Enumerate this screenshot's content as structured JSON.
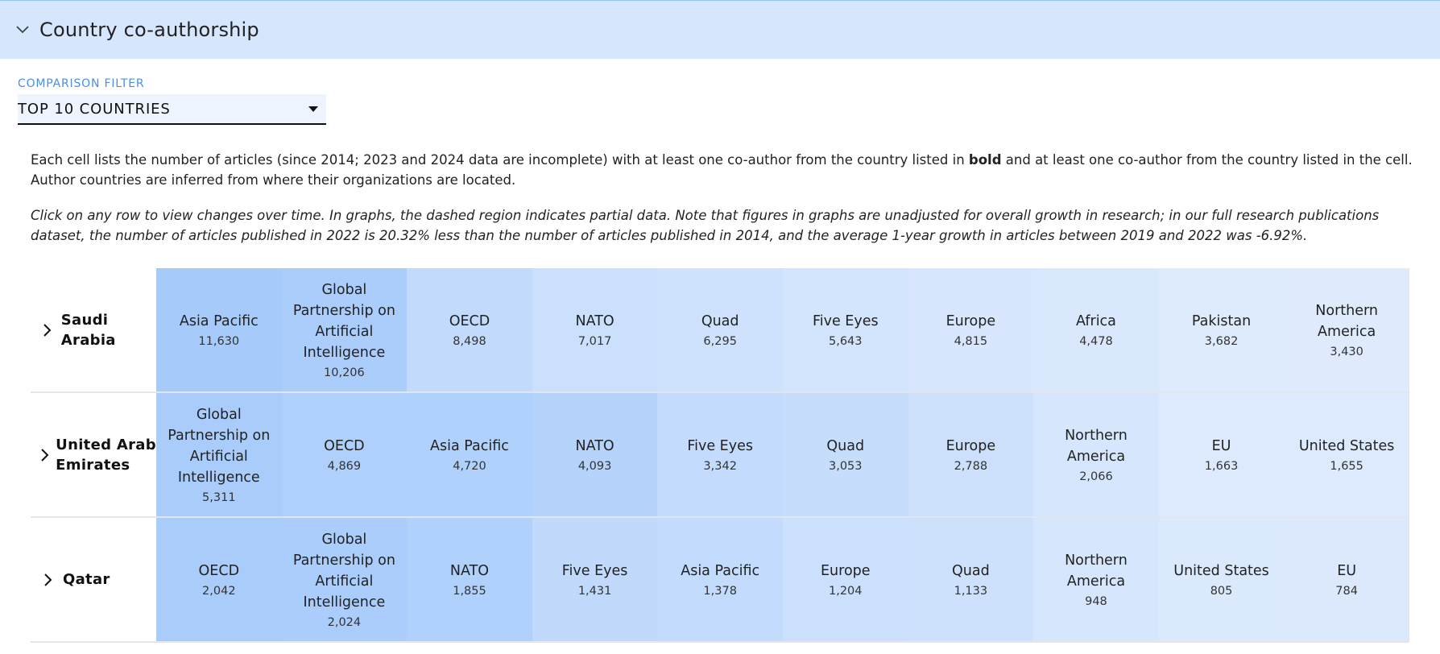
{
  "section": {
    "title": "Country co-authorship"
  },
  "filter": {
    "label": "COMPARISON FILTER",
    "value": "TOP 10 COUNTRIES"
  },
  "description": {
    "line1_pre": "Each cell lists the number of articles (since 2014; 2023 and 2024 data are incomplete) with at least one co-author from the country listed in ",
    "line1_bold": "bold",
    "line1_post": " and at least one co-author from the country listed in the cell. Author countries are inferred from where their organizations are located.",
    "note": "Click on any row to view changes over time. In graphs, the dashed region indicates partial data. Note that figures in graphs are unadjusted for overall growth in research; in our full research publications dataset, the number of articles published in 2022 is 20.32% less than the number of articles published in 2014, and the average 1-year growth in articles between 2019 and 2022 was -6.92%."
  },
  "rows": [
    {
      "name": "Saudi Arabia",
      "cells": [
        {
          "label": "Asia Pacific",
          "value": "11,630",
          "color": "#a6cbfb"
        },
        {
          "label": "Global Partnership on Artificial Intelligence",
          "value": "10,206",
          "color": "#aacdfb"
        },
        {
          "label": "OECD",
          "value": "8,498",
          "color": "#c2dbfc"
        },
        {
          "label": "NATO",
          "value": "7,017",
          "color": "#cbe0fc"
        },
        {
          "label": "Quad",
          "value": "6,295",
          "color": "#cfe2fd"
        },
        {
          "label": "Five Eyes",
          "value": "5,643",
          "color": "#d3e4fd"
        },
        {
          "label": "Europe",
          "value": "4,815",
          "color": "#d8e7fd"
        },
        {
          "label": "Africa",
          "value": "4,478",
          "color": "#dae8fd"
        },
        {
          "label": "Pakistan",
          "value": "3,682",
          "color": "#deebfd"
        },
        {
          "label": "Northern America",
          "value": "3,430",
          "color": "#dfebfd"
        }
      ]
    },
    {
      "name": "United Arab Emirates",
      "cells": [
        {
          "label": "Global Partnership on Artificial Intelligence",
          "value": "5,311",
          "color": "#a9ccfb"
        },
        {
          "label": "OECD",
          "value": "4,869",
          "color": "#aed0fb"
        },
        {
          "label": "Asia Pacific",
          "value": "4,720",
          "color": "#b0d1fb"
        },
        {
          "label": "NATO",
          "value": "4,093",
          "color": "#b6d4fb"
        },
        {
          "label": "Five Eyes",
          "value": "3,342",
          "color": "#c3dbfc"
        },
        {
          "label": "Quad",
          "value": "3,053",
          "color": "#c7ddfc"
        },
        {
          "label": "Europe",
          "value": "2,788",
          "color": "#cce0fc"
        },
        {
          "label": "Northern America",
          "value": "2,066",
          "color": "#d6e6fd"
        },
        {
          "label": "EU",
          "value": "1,663",
          "color": "#ddeafd"
        },
        {
          "label": "United States",
          "value": "1,655",
          "color": "#ddeafd"
        }
      ]
    },
    {
      "name": "Qatar",
      "cells": [
        {
          "label": "OECD",
          "value": "2,042",
          "color": "#a9ccfb"
        },
        {
          "label": "Global Partnership on Artificial Intelligence",
          "value": "2,024",
          "color": "#aacdfb"
        },
        {
          "label": "NATO",
          "value": "1,855",
          "color": "#b0d1fb"
        },
        {
          "label": "Five Eyes",
          "value": "1,431",
          "color": "#c1dafc"
        },
        {
          "label": "Asia Pacific",
          "value": "1,378",
          "color": "#c3dbfc"
        },
        {
          "label": "Europe",
          "value": "1,204",
          "color": "#cbe0fc"
        },
        {
          "label": "Quad",
          "value": "1,133",
          "color": "#cee1fc"
        },
        {
          "label": "Northern America",
          "value": "948",
          "color": "#d6e6fd"
        },
        {
          "label": "United States",
          "value": "805",
          "color": "#dbe9fd"
        },
        {
          "label": "EU",
          "value": "784",
          "color": "#dce9fd"
        }
      ]
    }
  ]
}
